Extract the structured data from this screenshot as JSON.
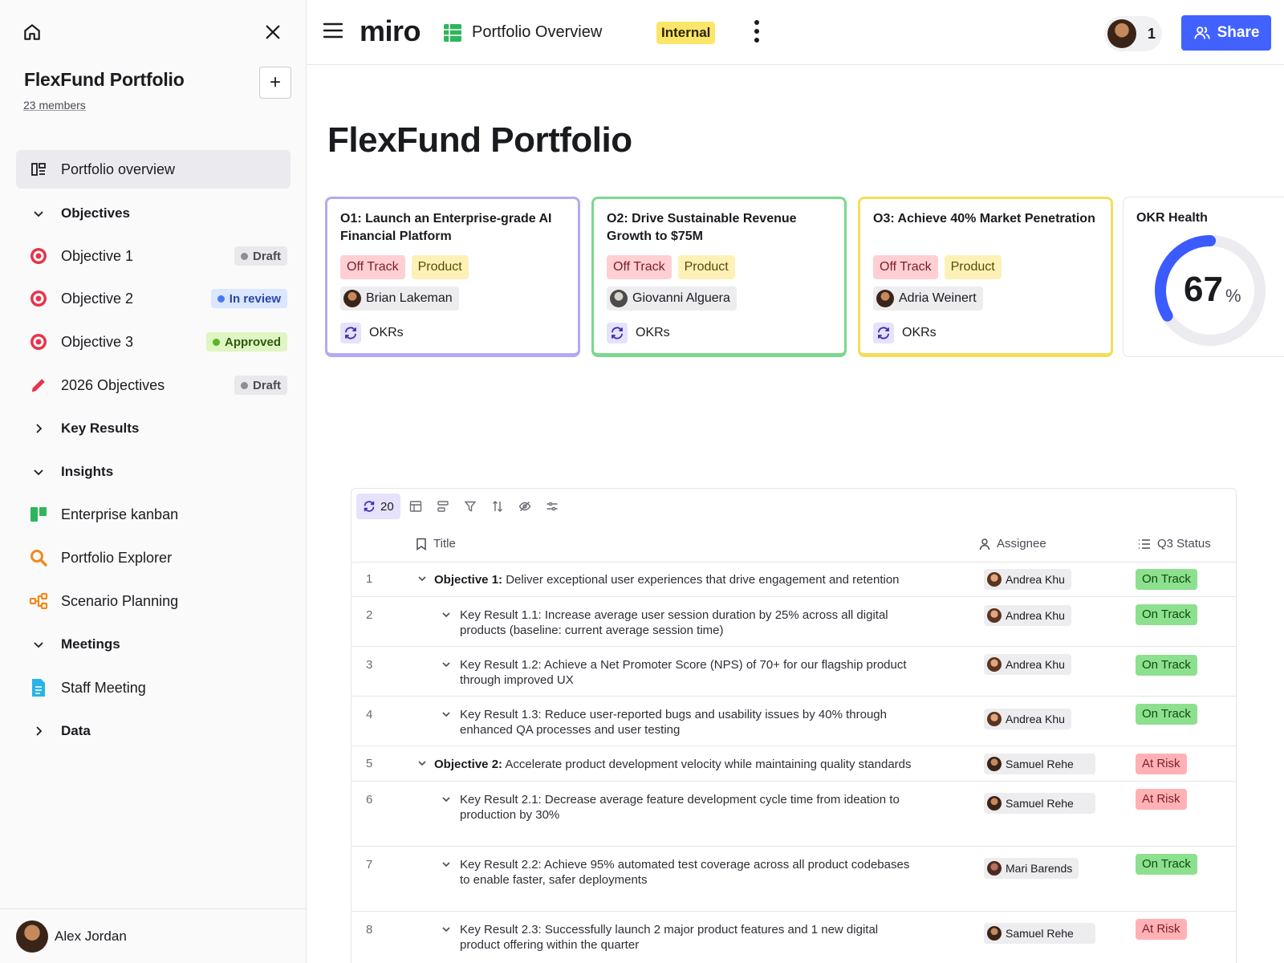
{
  "sidebar": {
    "workspace_title": "FlexFund Portfolio",
    "members_link": "23 members",
    "add_button": "+",
    "items": [
      {
        "label": "Portfolio overview"
      },
      {
        "label": "Objectives"
      },
      {
        "label": "Objective 1",
        "badge": "Draft"
      },
      {
        "label": "Objective 2",
        "badge": "In review"
      },
      {
        "label": "Objective 3",
        "badge": "Approved"
      },
      {
        "label": "2026 Objectives",
        "badge": "Draft"
      },
      {
        "label": "Key Results"
      },
      {
        "label": "Insights"
      },
      {
        "label": "Enterprise kanban"
      },
      {
        "label": "Portfolio Explorer"
      },
      {
        "label": "Scenario Planning"
      },
      {
        "label": "Meetings"
      },
      {
        "label": "Staff Meeting"
      },
      {
        "label": "Data"
      }
    ],
    "user_name": "Alex Jordan"
  },
  "topbar": {
    "logo": "miro",
    "board_title": "Portfolio Overview",
    "label": "Internal",
    "collaborator_count": "1",
    "share_label": "Share",
    "accent_color": "#4262ff"
  },
  "main": {
    "title": "FlexFund Portfolio",
    "cards": [
      {
        "title": "O1: Launch an Enterprise-grade AI Financial Platform",
        "status": "Off Track",
        "category": "Product",
        "owner": "Brian Lakeman",
        "link": "OKRs",
        "color": "#b7a8f2"
      },
      {
        "title": "O2: Drive Sustainable Revenue Growth to $75M",
        "status": "Off Track",
        "category": "Product",
        "owner": "Giovanni Alguera",
        "link": "OKRs",
        "color": "#7bd88c"
      },
      {
        "title": "O3: Achieve 40% Market Penetration",
        "status": "Off Track",
        "category": "Product",
        "owner": "Adria Weinert",
        "link": "OKRs",
        "color": "#f3de5c"
      }
    ],
    "health": {
      "title": "OKR Health",
      "value": "67",
      "unit": "%",
      "fraction": 0.67
    }
  },
  "table": {
    "count": "20",
    "columns": {
      "title": "Title",
      "assignee": "Assignee",
      "status": "Q3 Status"
    },
    "rows": [
      {
        "num": "1",
        "prefix": "Objective 1:",
        "text": "Deliver exceptional user experiences that drive engagement and retention",
        "assignee": "Andrea Khu",
        "status": "On Track"
      },
      {
        "num": "2",
        "prefix": "",
        "text": "Key Result 1.1: Increase average user session duration by 25% across all digital products (baseline: current average session time)",
        "assignee": "Andrea Khu",
        "status": "On Track"
      },
      {
        "num": "3",
        "prefix": "",
        "text": "Key Result 1.2: Achieve a Net Promoter Score (NPS) of 70+ for our flagship product through improved UX",
        "assignee": "Andrea Khu",
        "status": "On Track"
      },
      {
        "num": "4",
        "prefix": "",
        "text": "Key Result 1.3: Reduce user-reported bugs and usability issues by 40% through enhanced QA processes and user testing",
        "assignee": "Andrea Khu",
        "status": "On Track"
      },
      {
        "num": "5",
        "prefix": "Objective 2:",
        "text": "Accelerate product development velocity while maintaining quality standards",
        "assignee": "Samuel Rehe",
        "status": "At Risk"
      },
      {
        "num": "6",
        "prefix": "",
        "text": "Key Result 2.1: Decrease average feature development cycle time from ideation to production by 30%",
        "assignee": "Samuel Rehe",
        "status": "At Risk"
      },
      {
        "num": "7",
        "prefix": "",
        "text": "Key Result 2.2: Achieve 95% automated test coverage across all product codebases to enable faster, safer deployments",
        "assignee": "Mari Barends",
        "status": "On Track"
      },
      {
        "num": "8",
        "prefix": "",
        "text": "Key Result 2.3: Successfully launch 2 major product features and 1 new digital product offering within the quarter",
        "assignee": "Samuel Rehe",
        "status": "At Risk"
      }
    ]
  }
}
